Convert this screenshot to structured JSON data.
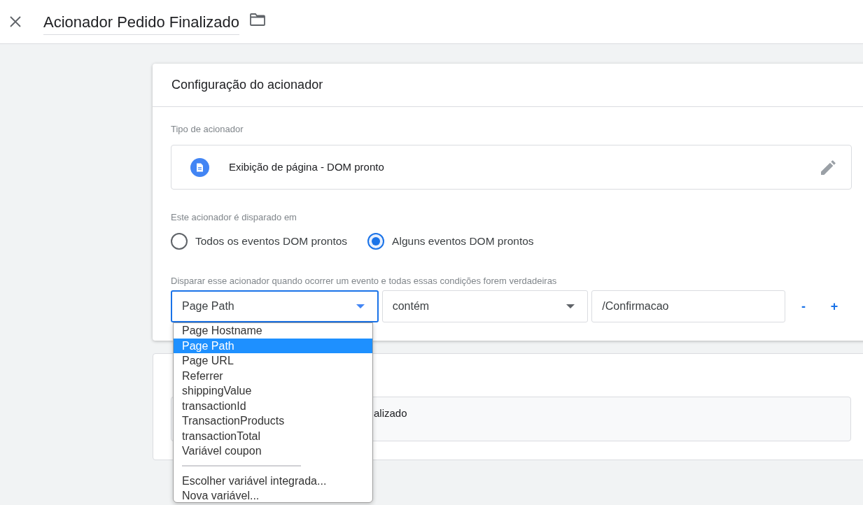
{
  "header": {
    "title": "Acionador Pedido Finalizado"
  },
  "trigger_config": {
    "title": "Configuração do acionador",
    "type_label": "Tipo de acionador",
    "trigger_type": "Exibição de página - DOM pronto",
    "fires_on_label": "Este acionador é disparado em",
    "fires_on_options": [
      {
        "label": "Todos os eventos DOM prontos",
        "selected": false
      },
      {
        "label": "Alguns eventos DOM prontos",
        "selected": true
      }
    ],
    "condition_label": "Disparar esse acionador quando ocorrer um evento e todas essas condições forem verdadeiras",
    "condition": {
      "variable": {
        "value": "Page Path",
        "expanded": true
      },
      "operator": {
        "value": "contém",
        "expanded": false
      },
      "value": "/Confirmacao",
      "remove": "-",
      "add": "+"
    }
  },
  "variable_menu": {
    "items": [
      {
        "label": "Page Hostname",
        "selected": false
      },
      {
        "label": "Page Path",
        "selected": true
      },
      {
        "label": "Page URL",
        "selected": false
      },
      {
        "label": "Referrer",
        "selected": false
      },
      {
        "label": "shippingValue",
        "selected": false
      },
      {
        "label": "transactionId",
        "selected": false
      },
      {
        "label": "TransactionProducts",
        "selected": false
      },
      {
        "label": "transactionTotal",
        "selected": false
      },
      {
        "label": "Variável coupon",
        "selected": false
      }
    ],
    "actions": [
      "Escolher variável integrada...",
      "Nova variável..."
    ]
  },
  "second_card": {
    "field_text": "alizado"
  }
}
